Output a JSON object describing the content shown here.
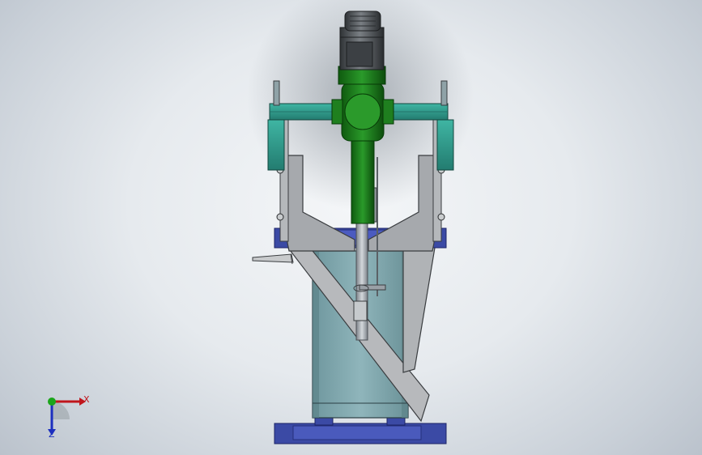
{
  "viewport": {
    "background": [
      "#f4f6f8",
      "#c9d0d8"
    ]
  },
  "model": {
    "components": [
      "motor-fan-cap",
      "motor-housing",
      "gearbox-body",
      "mounting-crossbeam",
      "support-frame",
      "agitator-shaft",
      "tank-body",
      "base-frame",
      "slide-chute"
    ],
    "colors": {
      "motor": "#555a5e",
      "gearbox": "#1f7f1f",
      "crossbeam": "#2f9e8e",
      "frame": "#a6a9ad",
      "tank": "#7fa6ad",
      "base": "#3b4aa5",
      "shaft": "#9aa0a6"
    }
  },
  "triad": {
    "x_label": "X",
    "z_label": "Z",
    "x_color": "#c0161c",
    "z_color": "#1c2fbf",
    "y_color": "#1aa51a"
  }
}
